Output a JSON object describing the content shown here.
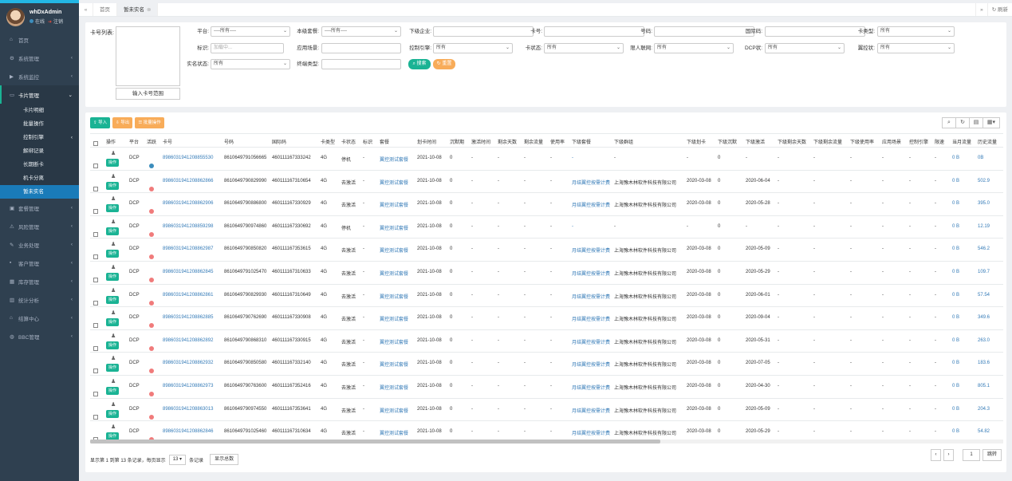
{
  "sidebar": {
    "user": {
      "name": "whDxAdmin",
      "online": "在线",
      "logout": "注销"
    },
    "items": [
      {
        "label": "首页",
        "icon": "home-icon",
        "chev": ""
      },
      {
        "label": "系统管理",
        "icon": "gear-icon",
        "chev": "‹"
      },
      {
        "label": "系统监控",
        "icon": "video-icon",
        "chev": "‹"
      },
      {
        "label": "卡片管理",
        "icon": "card-icon",
        "chev": "⌄"
      }
    ],
    "subitems": [
      {
        "label": "卡片明细",
        "chev": ""
      },
      {
        "label": "批量操作",
        "chev": ""
      },
      {
        "label": "控制引擎",
        "chev": "‹"
      },
      {
        "label": "解绑记录",
        "chev": ""
      },
      {
        "label": "长期断卡",
        "chev": ""
      },
      {
        "label": "机卡分离",
        "chev": ""
      },
      {
        "label": "暂未实名",
        "chev": ""
      }
    ],
    "items2": [
      {
        "label": "套餐管理",
        "icon": "box-icon"
      },
      {
        "label": "风险管理",
        "icon": "warning-icon"
      },
      {
        "label": "业务处理",
        "icon": "wrench-icon"
      },
      {
        "label": "客户管理",
        "icon": "user-icon"
      },
      {
        "label": "库存管理",
        "icon": "stock-icon"
      },
      {
        "label": "统计分析",
        "icon": "chart-icon"
      },
      {
        "label": "结算中心",
        "icon": "bank-icon"
      },
      {
        "label": "BBC管理",
        "icon": "globe-icon"
      }
    ]
  },
  "tabs": {
    "home": "首页",
    "active": "暂未实名",
    "refresh": "刷新"
  },
  "filter": {
    "cardlist": "卡号列表:",
    "range_btn": "输入卡号范围",
    "platform": {
      "label": "平台:",
      "value": "----所有----"
    },
    "package": {
      "label": "本级套餐:",
      "value": "----所有----"
    },
    "sub_company": {
      "label": "下级企业:",
      "value": ""
    },
    "cardno": {
      "label": "卡号:",
      "value": ""
    },
    "msisdn": {
      "label": "号码:",
      "value": ""
    },
    "iccid": {
      "label": "国际码:",
      "value": ""
    },
    "cardtype": {
      "label": "卡类型:",
      "value": "所有"
    },
    "tag": {
      "label": "标识:",
      "placeholder": "加载中..."
    },
    "scene": {
      "label": "应用场景:",
      "value": ""
    },
    "engine": {
      "label": "控制引擎:",
      "value": "所有"
    },
    "cardstate": {
      "label": "卡状态:",
      "value": "所有"
    },
    "iot": {
      "label": "限人联网:",
      "value": "所有"
    },
    "dcp": {
      "label": "DCP状:",
      "value": "所有"
    },
    "ctrl": {
      "label": "翼控状:",
      "value": "所有"
    },
    "realname": {
      "label": "实名状态:",
      "value": "所有"
    },
    "terminal": {
      "label": "终端类型:",
      "value": ""
    },
    "search": "搜索",
    "reset": "重置"
  },
  "toolbar": {
    "import": "导入",
    "export": "导出",
    "batch": "批量操作"
  },
  "columns": [
    "操作",
    "平台",
    "活跃",
    "卡号",
    "号码",
    "国际码",
    "卡类型",
    "卡状态",
    "标识",
    "套餐",
    "划卡时间",
    "沉默期",
    "激活时间",
    "剩余天数",
    "剩余流量",
    "使用率",
    "下级套餐",
    "下级群组",
    "下级划卡",
    "下级沉默",
    "下级激活",
    "下级剩余天数",
    "下级剩余流量",
    "下级使用率",
    "应用场景",
    "控制引擎",
    "限速",
    "当月流量",
    "历史流量"
  ],
  "rows": [
    {
      "op": "操作",
      "plat": "DCP",
      "dot": "#3c8dbc",
      "card": "8986031941208855530",
      "msisdn": "8610649791056665",
      "iccid": "460111167333242",
      "type": "4G",
      "state": "停机",
      "tag": "-",
      "pkg": "翼控测试套餐",
      "time": "2021-10-08",
      "silent": "0",
      "act": "-",
      "days": "-",
      "flow": "-",
      "rate": "-",
      "spkg": "-",
      "sgrp": "-",
      "scard": "-",
      "ssil": "0",
      "sact": "-",
      "sdays": "-",
      "sflow": "-",
      "srate": "-",
      "scene": "-",
      "eng": "-",
      "spd": "-",
      "month": "0 B",
      "hist": "0B"
    },
    {
      "op": "操作",
      "plat": "DCP",
      "dot": "#f07b7b",
      "card": "8986031941208862866",
      "msisdn": "8610649790829990",
      "iccid": "460111167310654",
      "type": "4G",
      "state": "去激活",
      "tag": "-",
      "pkg": "翼控测试套餐",
      "time": "2021-10-08",
      "silent": "0",
      "act": "-",
      "days": "-",
      "flow": "-",
      "rate": "-",
      "spkg": "月结翼控按需计费",
      "sgrp": "上海豫木林软件科技有限公司",
      "scard": "2020-03-08",
      "ssil": "0",
      "sact": "2020-06-04",
      "sdays": "-",
      "sflow": "-",
      "srate": "-",
      "scene": "-",
      "eng": "-",
      "spd": "-",
      "month": "0 B",
      "hist": "502.9"
    },
    {
      "op": "操作",
      "plat": "DCP",
      "dot": "#f07b7b",
      "card": "8986031941208862906",
      "msisdn": "8610649790886800",
      "iccid": "460111167330929",
      "type": "4G",
      "state": "去激活",
      "tag": "-",
      "pkg": "翼控测试套餐",
      "time": "2021-10-08",
      "silent": "0",
      "act": "-",
      "days": "-",
      "flow": "-",
      "rate": "-",
      "spkg": "月结翼控按需计费",
      "sgrp": "上海豫木林软件科技有限公司",
      "scard": "2020-03-08",
      "ssil": "0",
      "sact": "2020-05-28",
      "sdays": "-",
      "sflow": "-",
      "srate": "-",
      "scene": "-",
      "eng": "-",
      "spd": "-",
      "month": "0 B",
      "hist": "395.0"
    },
    {
      "op": "操作",
      "plat": "DCP",
      "dot": "#f07b7b",
      "card": "8986031941208859298",
      "msisdn": "8610649790974860",
      "iccid": "460111167330692",
      "type": "4G",
      "state": "停机",
      "tag": "-",
      "pkg": "翼控测试套餐",
      "time": "2021-10-08",
      "silent": "0",
      "act": "-",
      "days": "-",
      "flow": "-",
      "rate": "-",
      "spkg": "-",
      "sgrp": "-",
      "scard": "-",
      "ssil": "0",
      "sact": "-",
      "sdays": "-",
      "sflow": "-",
      "srate": "-",
      "scene": "-",
      "eng": "-",
      "spd": "-",
      "month": "0 B",
      "hist": "12.19"
    },
    {
      "op": "操作",
      "plat": "DCP",
      "dot": "#f07b7b",
      "card": "8986031941208862987",
      "msisdn": "8610649790850820",
      "iccid": "460111167353615",
      "type": "4G",
      "state": "去激活",
      "tag": "-",
      "pkg": "翼控测试套餐",
      "time": "2021-10-08",
      "silent": "0",
      "act": "-",
      "days": "-",
      "flow": "-",
      "rate": "-",
      "spkg": "月结翼控按需计费",
      "sgrp": "上海豫木林软件科技有限公司",
      "scard": "2020-03-08",
      "ssil": "0",
      "sact": "2020-05-09",
      "sdays": "-",
      "sflow": "-",
      "srate": "-",
      "scene": "-",
      "eng": "-",
      "spd": "-",
      "month": "0 B",
      "hist": "546.2"
    },
    {
      "op": "操作",
      "plat": "DCP",
      "dot": "#f07b7b",
      "card": "8986031941208862845",
      "msisdn": "8610649791025470",
      "iccid": "460111167310633",
      "type": "4G",
      "state": "去激活",
      "tag": "-",
      "pkg": "翼控测试套餐",
      "time": "2021-10-08",
      "silent": "0",
      "act": "-",
      "days": "-",
      "flow": "-",
      "rate": "-",
      "spkg": "月结翼控按需计费",
      "sgrp": "上海豫木林软件科技有限公司",
      "scard": "2020-03-08",
      "ssil": "0",
      "sact": "2020-05-29",
      "sdays": "-",
      "sflow": "-",
      "srate": "-",
      "scene": "-",
      "eng": "-",
      "spd": "-",
      "month": "0 B",
      "hist": "109.7"
    },
    {
      "op": "操作",
      "plat": "DCP",
      "dot": "#f07b7b",
      "card": "8986031941208862861",
      "msisdn": "8610649790829930",
      "iccid": "460111167310649",
      "type": "4G",
      "state": "去激活",
      "tag": "-",
      "pkg": "翼控测试套餐",
      "time": "2021-10-08",
      "silent": "0",
      "act": "-",
      "days": "-",
      "flow": "-",
      "rate": "-",
      "spkg": "月结翼控按需计费",
      "sgrp": "上海豫木林软件科技有限公司",
      "scard": "2020-03-08",
      "ssil": "0",
      "sact": "2020-06-01",
      "sdays": "-",
      "sflow": "-",
      "srate": "-",
      "scene": "-",
      "eng": "-",
      "spd": "-",
      "month": "0 B",
      "hist": "57.54"
    },
    {
      "op": "操作",
      "plat": "DCP",
      "dot": "#f07b7b",
      "card": "8986031941208862885",
      "msisdn": "8610649790762690",
      "iccid": "460111167330908",
      "type": "4G",
      "state": "去激活",
      "tag": "-",
      "pkg": "翼控测试套餐",
      "time": "2021-10-08",
      "silent": "0",
      "act": "-",
      "days": "-",
      "flow": "-",
      "rate": "-",
      "spkg": "月结翼控按需计费",
      "sgrp": "上海豫木林软件科技有限公司",
      "scard": "2020-03-08",
      "ssil": "0",
      "sact": "2020-09-04",
      "sdays": "-",
      "sflow": "-",
      "srate": "-",
      "scene": "-",
      "eng": "-",
      "spd": "-",
      "month": "0 B",
      "hist": "349.6"
    },
    {
      "op": "操作",
      "plat": "DCP",
      "dot": "#f07b7b",
      "card": "8986031941208862892",
      "msisdn": "8610649790868310",
      "iccid": "460111167330915",
      "type": "4G",
      "state": "去激活",
      "tag": "-",
      "pkg": "翼控测试套餐",
      "time": "2021-10-08",
      "silent": "0",
      "act": "-",
      "days": "-",
      "flow": "-",
      "rate": "-",
      "spkg": "月结翼控按需计费",
      "sgrp": "上海豫木林软件科技有限公司",
      "scard": "2020-03-08",
      "ssil": "0",
      "sact": "2020-05-31",
      "sdays": "-",
      "sflow": "-",
      "srate": "-",
      "scene": "-",
      "eng": "-",
      "spd": "-",
      "month": "0 B",
      "hist": "263.0"
    },
    {
      "op": "操作",
      "plat": "DCP",
      "dot": "#f07b7b",
      "card": "8986031941208862932",
      "msisdn": "8610649790850580",
      "iccid": "460111167332140",
      "type": "4G",
      "state": "去激活",
      "tag": "-",
      "pkg": "翼控测试套餐",
      "time": "2021-10-08",
      "silent": "0",
      "act": "-",
      "days": "-",
      "flow": "-",
      "rate": "-",
      "spkg": "月结翼控按需计费",
      "sgrp": "上海豫木林软件科技有限公司",
      "scard": "2020-03-08",
      "ssil": "0",
      "sact": "2020-07-05",
      "sdays": "-",
      "sflow": "-",
      "srate": "-",
      "scene": "-",
      "eng": "-",
      "spd": "-",
      "month": "0 B",
      "hist": "183.6"
    },
    {
      "op": "操作",
      "plat": "DCP",
      "dot": "#f07b7b",
      "card": "8986031941208862973",
      "msisdn": "8610649790763600",
      "iccid": "460111167352416",
      "type": "4G",
      "state": "去激活",
      "tag": "-",
      "pkg": "翼控测试套餐",
      "time": "2021-10-08",
      "silent": "0",
      "act": "-",
      "days": "-",
      "flow": "-",
      "rate": "-",
      "spkg": "月结翼控按需计费",
      "sgrp": "上海豫木林软件科技有限公司",
      "scard": "2020-03-08",
      "ssil": "0",
      "sact": "2020-04-30",
      "sdays": "-",
      "sflow": "-",
      "srate": "-",
      "scene": "-",
      "eng": "-",
      "spd": "-",
      "month": "0 B",
      "hist": "805.1"
    },
    {
      "op": "操作",
      "plat": "DCP",
      "dot": "#f07b7b",
      "card": "8986031941208863013",
      "msisdn": "8610649790974550",
      "iccid": "460111167353641",
      "type": "4G",
      "state": "去激活",
      "tag": "-",
      "pkg": "翼控测试套餐",
      "time": "2021-10-08",
      "silent": "0",
      "act": "-",
      "days": "-",
      "flow": "-",
      "rate": "-",
      "spkg": "月结翼控按需计费",
      "sgrp": "上海豫木林软件科技有限公司",
      "scard": "2020-03-08",
      "ssil": "0",
      "sact": "2020-05-09",
      "sdays": "-",
      "sflow": "-",
      "srate": "-",
      "scene": "-",
      "eng": "-",
      "spd": "-",
      "month": "0 B",
      "hist": "204.3"
    },
    {
      "op": "操作",
      "plat": "DCP",
      "dot": "#f07b7b",
      "card": "8986031941208862846",
      "msisdn": "8610649791025460",
      "iccid": "460111167310634",
      "type": "4G",
      "state": "去激活",
      "tag": "-",
      "pkg": "翼控测试套餐",
      "time": "2021-10-08",
      "silent": "0",
      "act": "-",
      "days": "-",
      "flow": "-",
      "rate": "-",
      "spkg": "月结翼控按需计费",
      "sgrp": "上海豫木林软件科技有限公司",
      "scard": "2020-03-08",
      "ssil": "0",
      "sact": "2020-05-29",
      "sdays": "-",
      "sflow": "-",
      "srate": "-",
      "scene": "-",
      "eng": "-",
      "spd": "-",
      "month": "0 B",
      "hist": "54.82"
    }
  ],
  "pager": {
    "info": "显示第 1 到第 13 条记录，每页显示",
    "size": "13",
    "suffix": "条记录",
    "show_total": "显示总数",
    "page": "1",
    "go": "跳转"
  }
}
